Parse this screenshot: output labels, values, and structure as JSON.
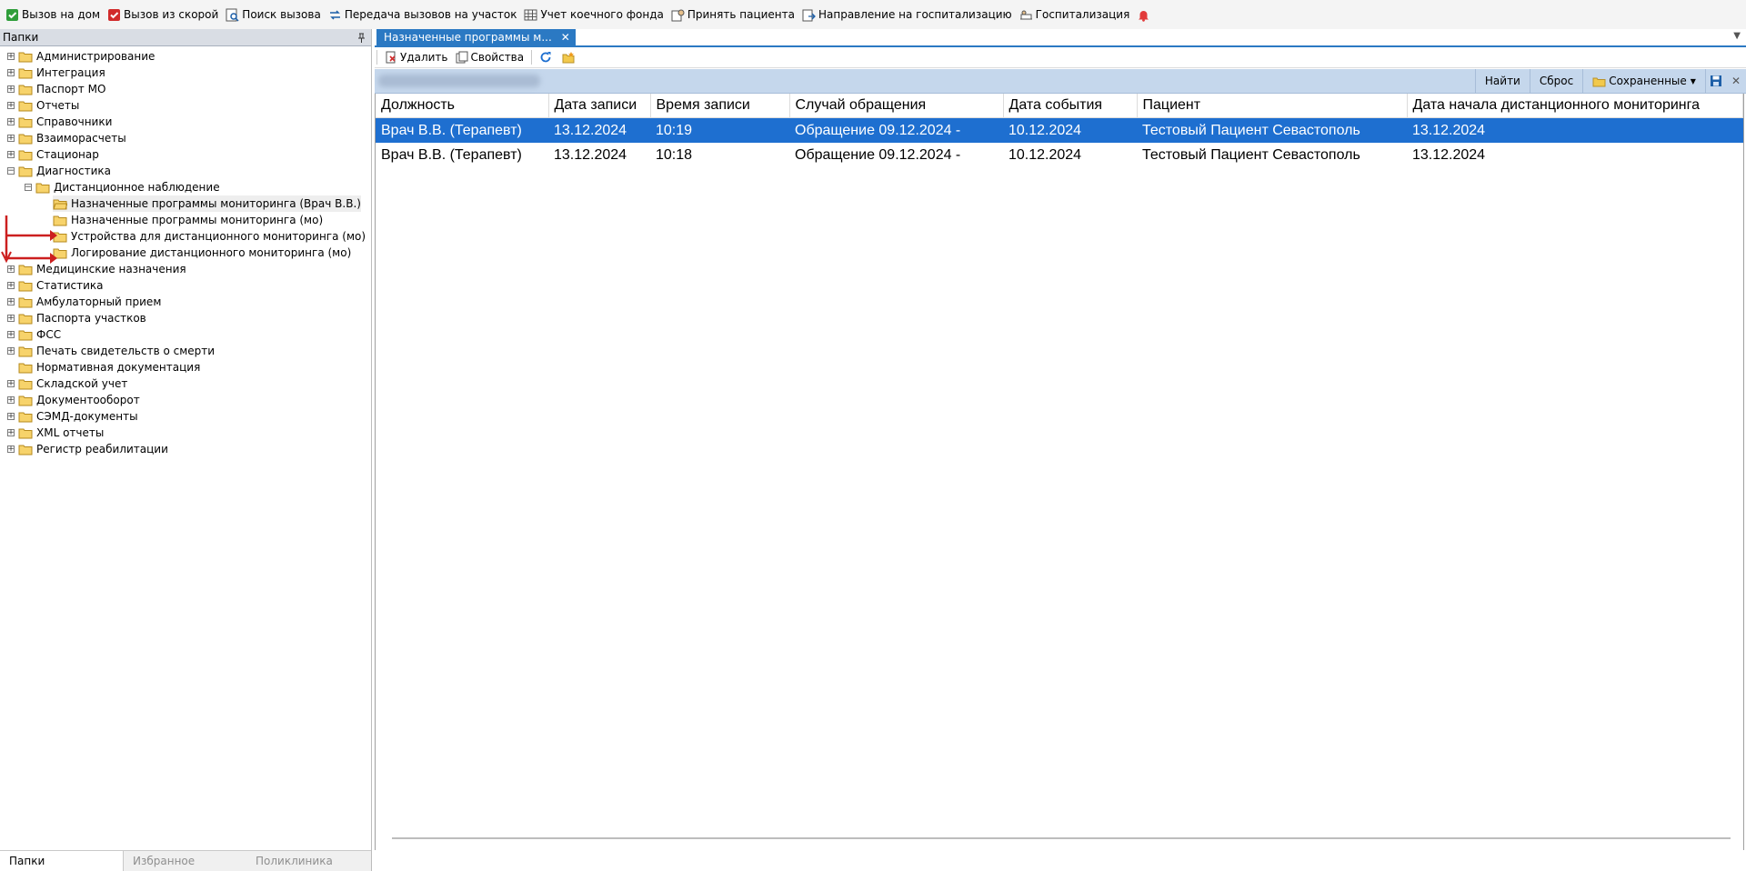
{
  "toolbar": {
    "items": [
      {
        "label": "Вызов на дом",
        "icon": "check-doc-icon"
      },
      {
        "label": "Вызов из скорой",
        "icon": "red-check-doc-icon"
      },
      {
        "label": "Поиск вызова",
        "icon": "search-doc-icon"
      },
      {
        "label": "Передача вызовов на участок",
        "icon": "transfer-icon"
      },
      {
        "label": "Учет коечного фонда",
        "icon": "bed-fund-icon"
      },
      {
        "label": "Принять пациента",
        "icon": "accept-patient-icon"
      },
      {
        "label": "Направление на госпитализацию",
        "icon": "referral-icon"
      },
      {
        "label": "Госпитализация",
        "icon": "hospitalization-icon"
      }
    ],
    "bell_icon": "bell-icon"
  },
  "left_panel": {
    "title": "Папки",
    "pin_icon": "pin-icon",
    "tree": [
      {
        "label": "Администрирование",
        "level": 0,
        "expand": "+"
      },
      {
        "label": "Интеграция",
        "level": 0,
        "expand": "+"
      },
      {
        "label": "Паспорт МО",
        "level": 0,
        "expand": "+"
      },
      {
        "label": "Отчеты",
        "level": 0,
        "expand": "+"
      },
      {
        "label": "Справочники",
        "level": 0,
        "expand": "+"
      },
      {
        "label": "Взаиморасчеты",
        "level": 0,
        "expand": "+"
      },
      {
        "label": "Стационар",
        "level": 0,
        "expand": "+"
      },
      {
        "label": "Диагностика",
        "level": 0,
        "expand": "-"
      },
      {
        "label": "Дистанционное наблюдение",
        "level": 1,
        "expand": "-"
      },
      {
        "label": "Назначенные программы мониторинга (Врач В.В.)",
        "level": 2,
        "expand": "",
        "selected": true
      },
      {
        "label": "Назначенные программы мониторинга (мо)",
        "level": 2,
        "expand": ""
      },
      {
        "label": "Устройства для дистанционного мониторинга (мо)",
        "level": 2,
        "expand": ""
      },
      {
        "label": "Логирование дистанционного мониторинга (мо)",
        "level": 2,
        "expand": ""
      },
      {
        "label": "Медицинские назначения",
        "level": 0,
        "expand": "+"
      },
      {
        "label": "Статистика",
        "level": 0,
        "expand": "+"
      },
      {
        "label": "Амбулаторный прием",
        "level": 0,
        "expand": "+"
      },
      {
        "label": "Паспорта участков",
        "level": 0,
        "expand": "+"
      },
      {
        "label": "ФСС",
        "level": 0,
        "expand": "+"
      },
      {
        "label": "Печать свидетельств о смерти",
        "level": 0,
        "expand": "+"
      },
      {
        "label": "Нормативная документация",
        "level": 0,
        "expand": ""
      },
      {
        "label": "Складской учет",
        "level": 0,
        "expand": "+"
      },
      {
        "label": "Документооборот",
        "level": 0,
        "expand": "+"
      },
      {
        "label": "СЭМД-документы",
        "level": 0,
        "expand": "+"
      },
      {
        "label": "XML отчеты",
        "level": 0,
        "expand": "+"
      },
      {
        "label": "Регистр реабилитации",
        "level": 0,
        "expand": "+"
      }
    ],
    "bottom_tabs": [
      "Папки",
      "Избранное",
      "Поликлиника"
    ]
  },
  "document": {
    "tab_label": "Назначенные программы м...",
    "toolbar": {
      "delete_label": "Удалить",
      "properties_label": "Свойства"
    },
    "filterbar": {
      "find_label": "Найти",
      "reset_label": "Сброс",
      "saved_label": "Сохраненные"
    },
    "grid": {
      "columns": [
        "Должность",
        "Дата записи",
        "Время записи",
        "Случай обращения",
        "Дата события",
        "Пациент",
        "Дата начала дистанционного мониторинга"
      ],
      "rows": [
        [
          "Врач В.В. (Терапевт)",
          "13.12.2024",
          "10:19",
          "Обращение 09.12.2024 -",
          "10.12.2024",
          "Тестовый Пациент Севастополь",
          "13.12.2024"
        ],
        [
          "Врач В.В. (Терапевт)",
          "13.12.2024",
          "10:18",
          "Обращение 09.12.2024 -",
          "10.12.2024",
          "Тестовый Пациент Севастополь",
          "13.12.2024"
        ]
      ],
      "selected_row": 0
    }
  },
  "colors": {
    "accent": "#2b79c3",
    "selection": "#1e6fd0",
    "annotation_arrow": "#cc1f1f",
    "filterbar": "#c5d7ec"
  }
}
